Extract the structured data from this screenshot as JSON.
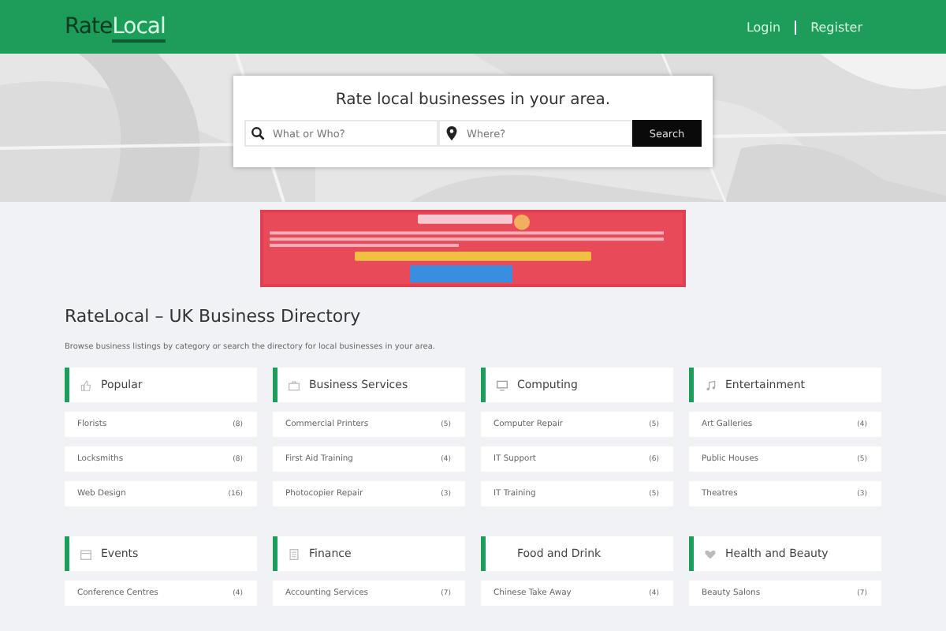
{
  "header": {
    "logo_first": "Rate",
    "logo_second": "Local",
    "links": [
      "Login",
      "Register"
    ]
  },
  "hero": {
    "kind": "picture",
    "heading": "Rate local businesses in your area.",
    "what": {
      "placeholder": "What or Who?"
    },
    "where": {
      "placeholder": "Where?"
    },
    "button": "Search"
  },
  "title": "RateLocal – UK Business Directory",
  "intro": "Browse business listings by category or search the directory for local businesses in your area.",
  "categories": [
    {
      "name": "Popular",
      "items": [
        {
          "name": "Florists",
          "count": "(8)"
        },
        {
          "name": "Locksmiths",
          "count": "(8)"
        },
        {
          "name": "Web Design",
          "count": "(16)"
        }
      ]
    },
    {
      "name": "Business Services",
      "items": [
        {
          "name": "Commercial Printers",
          "count": "(5)"
        },
        {
          "name": "First Aid Training",
          "count": "(4)"
        },
        {
          "name": "Photocopier Repair",
          "count": "(3)"
        }
      ]
    },
    {
      "name": "Computing",
      "items": [
        {
          "name": "Computer Repair",
          "count": "(5)"
        },
        {
          "name": "IT Support",
          "count": "(6)"
        },
        {
          "name": "IT Training",
          "count": "(5)"
        }
      ]
    },
    {
      "name": "Entertainment",
      "items": [
        {
          "name": "Art Galleries",
          "count": "(4)"
        },
        {
          "name": "Public Houses",
          "count": "(5)"
        },
        {
          "name": "Theatres",
          "count": "(3)"
        }
      ]
    },
    {
      "name": "Events",
      "items": [
        {
          "name": "Conference Centres",
          "count": "(4)"
        }
      ]
    },
    {
      "name": "Finance",
      "items": [
        {
          "name": "Accounting Services",
          "count": "(7)"
        }
      ]
    },
    {
      "name": "Food and Drink",
      "items": [
        {
          "name": "Chinese Take Away",
          "count": "(4)"
        }
      ]
    },
    {
      "name": "Health and Beauty",
      "items": [
        {
          "name": "Beauty Salons",
          "count": "(7)"
        }
      ]
    }
  ]
}
